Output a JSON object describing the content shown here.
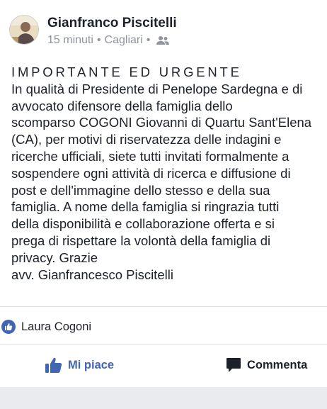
{
  "post": {
    "author": "Gianfranco Piscitelli",
    "time": "15 minuti",
    "separator": "•",
    "location": "Cagliari",
    "privacy_icon": "friends-icon",
    "body_lines": [
      "IMPORTANTE ED URGENTE",
      "In qualità di Presidente di Penelope Sardegna e di",
      "avvocato difensore della famiglia dello",
      "scomparso COGONI Giovanni di Quartu Sant'Elena",
      "(CA), per motivi di riservatezza delle indagini e",
      "ricerche ufficiali,  siete tutti invitati formalmente a",
      "sospendere ogni attività di ricerca e diffusione di",
      "post e dell'immagine dello stesso e della sua",
      "famiglia. A nome della famiglia si ringrazia tutti",
      "della disponibilità e collaborazione offerta e si",
      "prega di rispettare la volontà della famiglia di",
      "privacy. Grazie",
      "avv. Gianfrancesco Piscitelli"
    ]
  },
  "reactions": {
    "icon": "like-icon",
    "names": "Laura Cogoni"
  },
  "actions": {
    "like_label": "Mi piace",
    "comment_label": "Commenta"
  },
  "colors": {
    "accent": "#4267b2",
    "text": "#1d2129",
    "meta": "#90949c",
    "divider": "#dddfe2"
  }
}
